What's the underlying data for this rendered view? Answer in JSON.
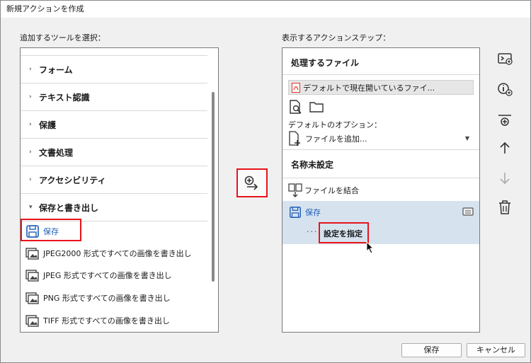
{
  "window": {
    "title": "新規アクションを作成"
  },
  "left": {
    "label": "追加するツールを選択：",
    "categories": [
      {
        "label": "フォーム",
        "expanded": false
      },
      {
        "label": "テキスト認識",
        "expanded": false
      },
      {
        "label": "保護",
        "expanded": false
      },
      {
        "label": "文書処理",
        "expanded": false
      },
      {
        "label": "アクセシビリティ",
        "expanded": false
      },
      {
        "label": "保存と書き出し",
        "expanded": true
      }
    ],
    "tools": [
      {
        "label": "保存",
        "icon": "save-icon",
        "selected": true
      },
      {
        "label": "JPEG2000 形式ですべての画像を書き出し",
        "icon": "export-image-icon"
      },
      {
        "label": "JPEG 形式ですべての画像を書き出し",
        "icon": "export-image-icon"
      },
      {
        "label": "PNG 形式ですべての画像を書き出し",
        "icon": "export-image-icon"
      },
      {
        "label": "TIFF 形式ですべての画像を書き出し",
        "icon": "export-image-icon"
      }
    ]
  },
  "right": {
    "label": "表示するアクションステップ：",
    "files_header": "処理するファイル",
    "default_file": "デフォルトで現在開いているファイ...",
    "options_label": "デフォルトのオプション：",
    "add_file": "ファイルを追加...",
    "group_header": "名称未設定",
    "steps": [
      {
        "label": "ファイルを結合",
        "icon": "combine-files-icon"
      },
      {
        "label": "保存",
        "icon": "save-icon",
        "selected": true
      }
    ],
    "specify_settings": "設定を指定"
  },
  "buttons": {
    "save": "保存",
    "cancel": "キャンセル"
  },
  "colors": {
    "accent": "#1f5fb8",
    "highlight": "#e8141b",
    "selection": "#d6e3ef"
  }
}
